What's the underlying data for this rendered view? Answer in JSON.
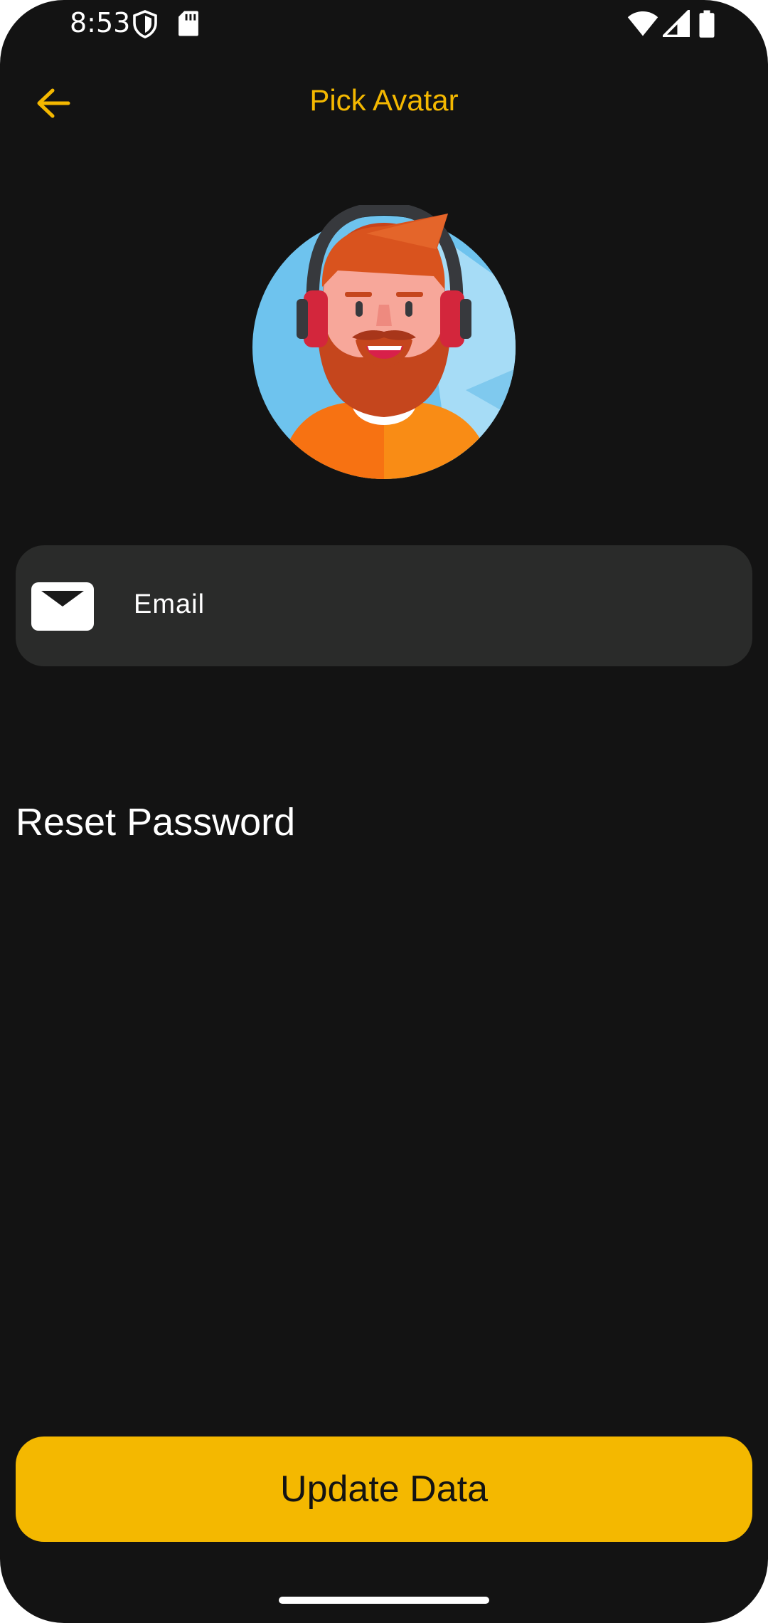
{
  "status_bar": {
    "time": "8:53",
    "icons": [
      "shield-icon",
      "sd-card-icon",
      "wifi-icon",
      "signal-icon",
      "battery-icon"
    ]
  },
  "app_bar": {
    "back_icon": "arrow-back-icon",
    "title": "Pick Avatar"
  },
  "avatar": {
    "icon": "bearded-man-headphones-avatar"
  },
  "email": {
    "icon": "mail-icon",
    "label": "Email"
  },
  "reset_password": {
    "label": "Reset Password"
  },
  "update_button": {
    "label": "Update Data"
  },
  "colors": {
    "background": "#131313",
    "accent": "#F4B800",
    "field_background": "#2a2b2a",
    "text": "#ffffff"
  }
}
